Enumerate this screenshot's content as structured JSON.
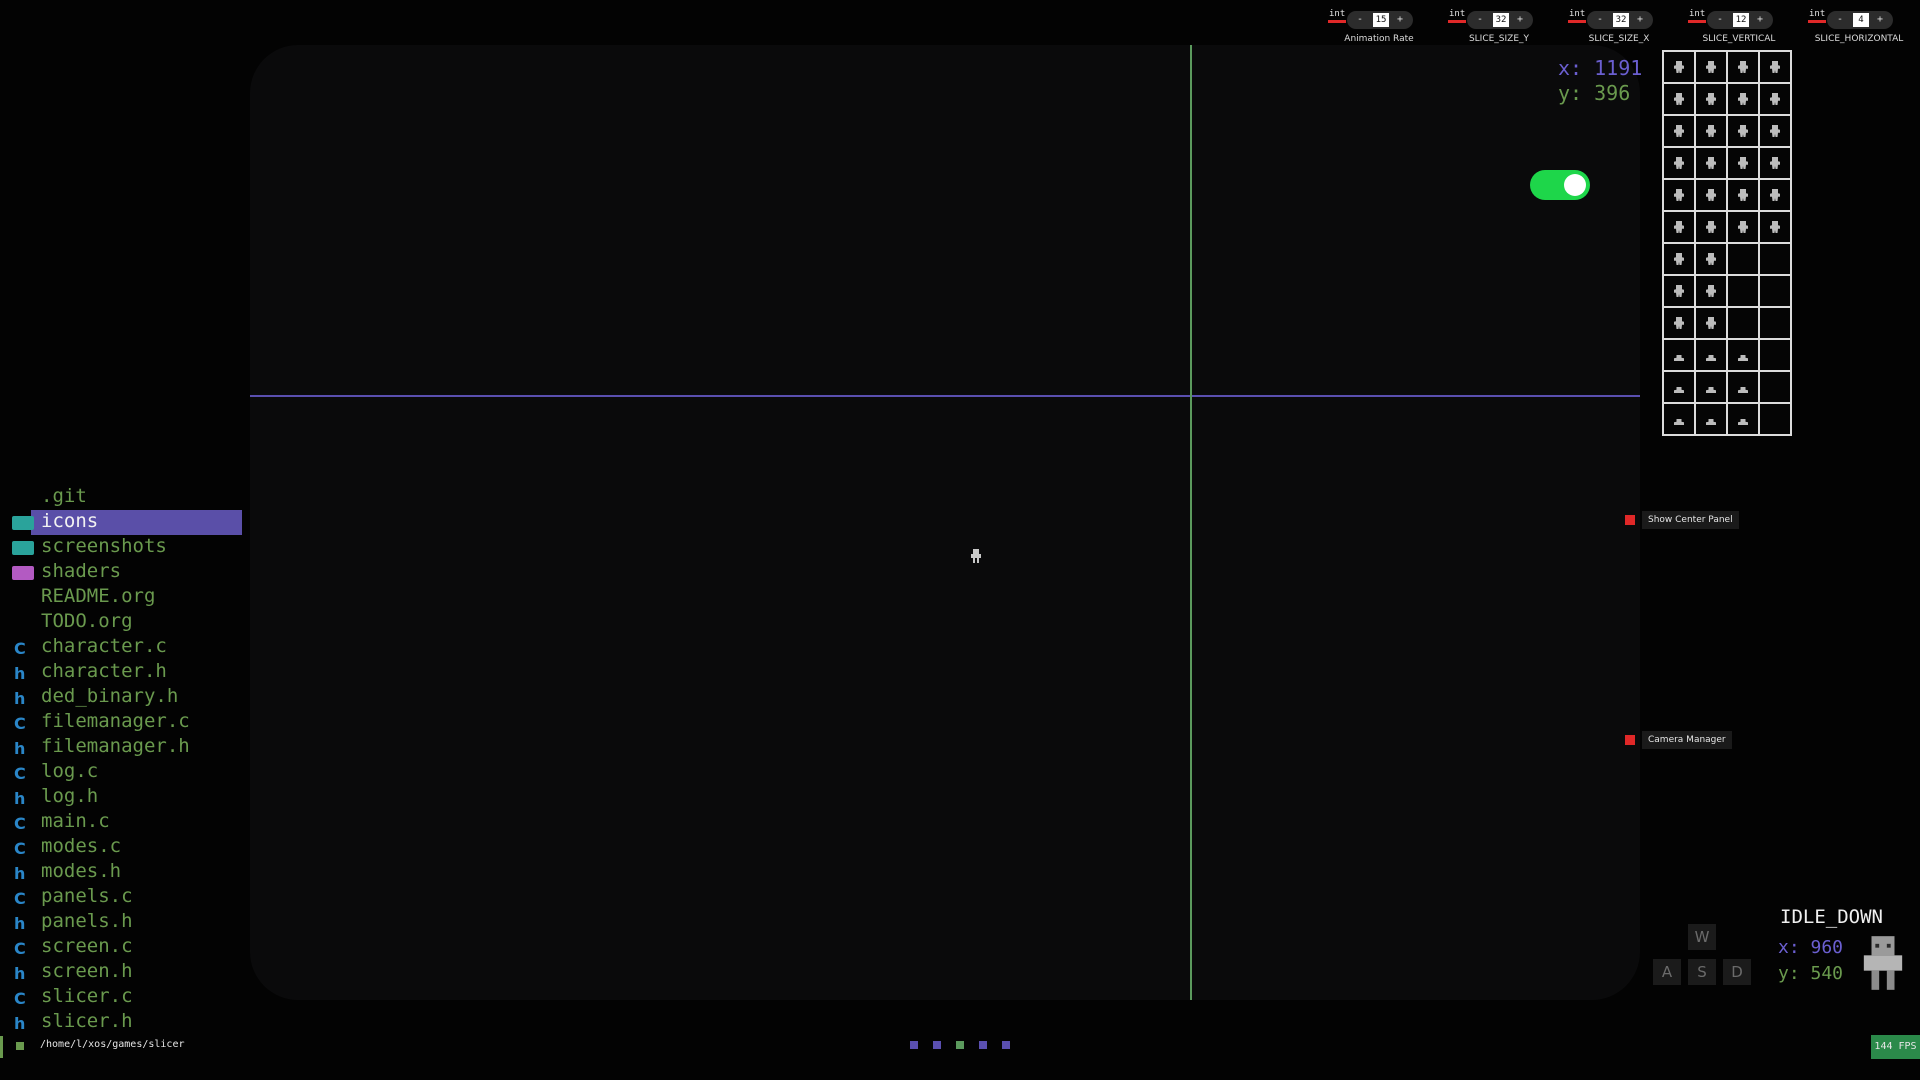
{
  "colors": {
    "background": "#030303",
    "viewport": "#0a0a0b",
    "axis_horizontal": "#5a4fb0",
    "axis_vertical": "#5b9a5d",
    "text_green": "#6a9a4e",
    "text_purple": "#6b5fd1",
    "selection": "#5a4fa8",
    "toggle_on": "#1ed64a",
    "panel_indicator": "#e02828",
    "fps_bg": "#2b8a4a"
  },
  "cursor": {
    "x_label": "x: 1191",
    "y_label": "y: 396"
  },
  "toggle": {
    "state": "on"
  },
  "controls": [
    {
      "type": "int",
      "value": "15",
      "minus": "-",
      "plus": "+",
      "label": "Animation Rate"
    },
    {
      "type": "int",
      "value": "32",
      "minus": "-",
      "plus": "+",
      "label": "SLICE_SIZE_Y"
    },
    {
      "type": "int",
      "value": "32",
      "minus": "-",
      "plus": "+",
      "label": "SLICE_SIZE_X"
    },
    {
      "type": "int",
      "value": "12",
      "minus": "-",
      "plus": "+",
      "label": "SLICE_VERTICAL"
    },
    {
      "type": "int",
      "value": "4",
      "minus": "-",
      "plus": "+",
      "label": "SLICE_HORIZONTAL"
    }
  ],
  "sprite_grid": {
    "rows": 12,
    "cols": 4,
    "filled_per_row": [
      4,
      4,
      4,
      4,
      4,
      4,
      2,
      2,
      2,
      3,
      3,
      3
    ],
    "low_rows": [
      9,
      10,
      11
    ]
  },
  "panels": {
    "center": "Show Center Panel",
    "camera": "Camera Manager"
  },
  "files": [
    {
      "name": ".git",
      "icon": "none"
    },
    {
      "name": "icons",
      "icon": "folder-image-icon",
      "selected": true
    },
    {
      "name": "screenshots",
      "icon": "folder-image-icon"
    },
    {
      "name": "shaders",
      "icon": "folder-shader-icon"
    },
    {
      "name": "README.org",
      "icon": "none"
    },
    {
      "name": "TODO.org",
      "icon": "none"
    },
    {
      "name": "character.c",
      "icon": "c"
    },
    {
      "name": "character.h",
      "icon": "h"
    },
    {
      "name": "ded_binary.h",
      "icon": "h"
    },
    {
      "name": "filemanager.c",
      "icon": "c"
    },
    {
      "name": "filemanager.h",
      "icon": "h"
    },
    {
      "name": "log.c",
      "icon": "c"
    },
    {
      "name": "log.h",
      "icon": "h"
    },
    {
      "name": "main.c",
      "icon": "c"
    },
    {
      "name": "modes.c",
      "icon": "c"
    },
    {
      "name": "modes.h",
      "icon": "h"
    },
    {
      "name": "panels.c",
      "icon": "c"
    },
    {
      "name": "panels.h",
      "icon": "h"
    },
    {
      "name": "screen.c",
      "icon": "c"
    },
    {
      "name": "screen.h",
      "icon": "h"
    },
    {
      "name": "slicer.c",
      "icon": "c"
    },
    {
      "name": "slicer.h",
      "icon": "h"
    }
  ],
  "status": {
    "path": "/home/l/xos/games/slicer",
    "fps": "144 FPS",
    "dots": [
      "#5a4fb0",
      "#5a4fb0",
      "#5b9a5d",
      "#5a4fb0",
      "#5a4fb0"
    ]
  },
  "keys": {
    "w": "W",
    "a": "A",
    "s": "S",
    "d": "D"
  },
  "player": {
    "state": "IDLE_DOWN",
    "x_label": "x: 960",
    "y_label": "y: 540"
  }
}
